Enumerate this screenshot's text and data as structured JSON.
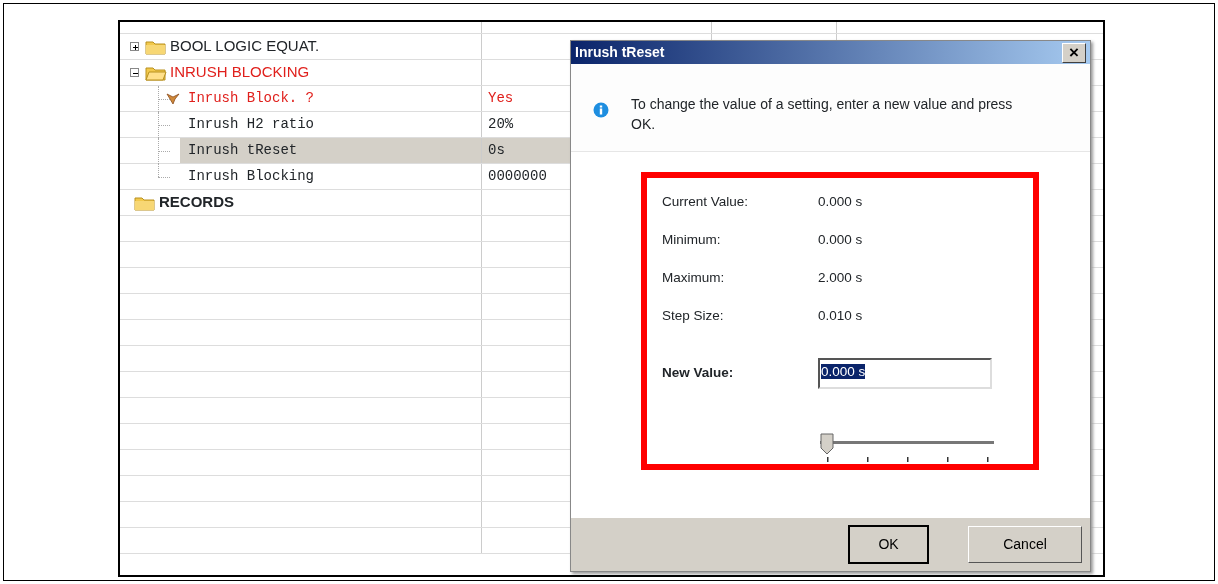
{
  "tree": [
    {
      "label": "BOOL LOGIC EQUAT.",
      "expanded": false,
      "modified": false,
      "bold": false
    },
    {
      "label": "INRUSH BLOCKING",
      "expanded": true,
      "modified": true,
      "bold": false,
      "children": [
        {
          "label": "Inrush Block. ?",
          "value": "Yes",
          "modified": true,
          "selected": false
        },
        {
          "label": "Inrush H2 ratio",
          "value": "20%",
          "modified": false,
          "selected": false
        },
        {
          "label": "Inrush tReset",
          "value": "0s",
          "modified": false,
          "selected": true
        },
        {
          "label": "Inrush Blocking",
          "value": "0000000",
          "modified": false,
          "selected": false
        }
      ]
    },
    {
      "label": "RECORDS",
      "modified": false,
      "bold": true
    }
  ],
  "dialog": {
    "title": "Inrush tReset",
    "close": "×",
    "message": "To change the value of a setting, enter a new value and press OK.",
    "fields": [
      {
        "label": "Current Value:",
        "value": "0.000 s"
      },
      {
        "label": "Minimum:",
        "value": "0.000 s"
      },
      {
        "label": "Maximum:",
        "value": "2.000 s"
      },
      {
        "label": "Step Size:",
        "value": "0.010 s"
      }
    ],
    "new_value": {
      "label": "New Value:",
      "value": "0.000 s"
    },
    "slider": {
      "level": 0
    },
    "buttons": [
      {
        "label": "OK",
        "default": true
      },
      {
        "label": "Cancel",
        "default": false
      }
    ]
  }
}
